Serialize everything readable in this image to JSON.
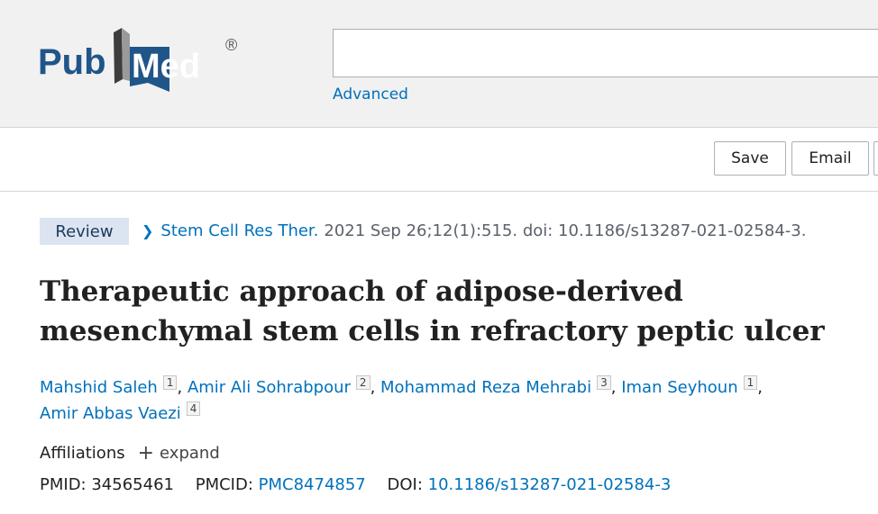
{
  "header": {
    "logo_text": "PubMed",
    "logo_mark": "®",
    "search_value": "",
    "advanced_label": "Advanced"
  },
  "toolbar": {
    "save_label": "Save",
    "email_label": "Email"
  },
  "article": {
    "type_badge": "Review",
    "journal": "Stem Cell Res Ther.",
    "citation": "2021 Sep 26;12(1):515. doi: 10.1186/s13287-021-02584-3.",
    "title_line1": "Therapeutic approach of adipose-derived",
    "title_line2": "mesenchymal stem cells in refractory peptic ulcer",
    "authors": [
      {
        "name": "Mahshid Saleh",
        "aff": "1"
      },
      {
        "name": "Amir Ali Sohrabpour",
        "aff": "2"
      },
      {
        "name": "Mohammad Reza Mehrabi",
        "aff": "3"
      },
      {
        "name": "Iman Seyhoun",
        "aff": "1"
      },
      {
        "name": "Amir Abbas Vaezi",
        "aff": "4"
      }
    ],
    "affiliations_label": "Affiliations",
    "expand_label": "expand",
    "pmid_label": "PMID:",
    "pmid": "34565461",
    "pmcid_label": "PMCID:",
    "pmcid": "PMC8474857",
    "doi_label": "DOI:",
    "doi": "10.1186/s13287-021-02584-3"
  },
  "colors": {
    "link": "#0071bc",
    "logo_blue": "#20558a",
    "badge_bg": "#dbe4f0",
    "header_bg": "#f1f1f1"
  },
  "icons": [
    "pubmed-logo-icon",
    "chevron-right-icon",
    "plus-icon"
  ]
}
